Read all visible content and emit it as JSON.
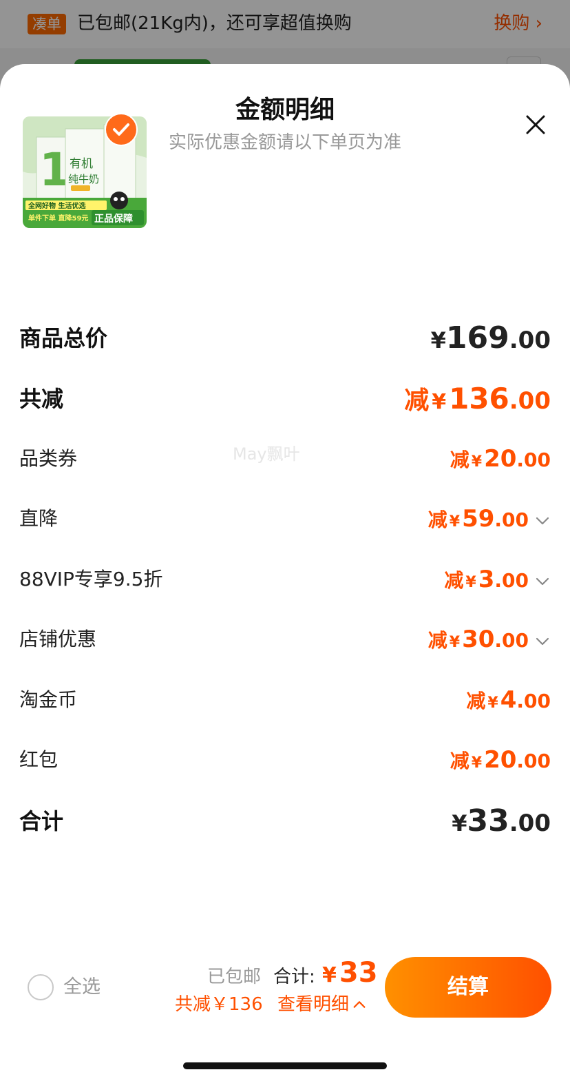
{
  "background": {
    "tag": "凑单",
    "text": "已包邮(21Kg内)，还可享超值换购",
    "link": "换购 ›"
  },
  "sheet": {
    "title": "金额明细",
    "subtitle": "实际优惠金额请以下单页为准",
    "close_icon": "close-icon"
  },
  "product": {
    "image_texts": [
      "有机",
      "纯牛奶",
      "全网好物 生活优选",
      "单件下单 直降59元",
      "正品保障"
    ],
    "selected": true
  },
  "rows": [
    {
      "label": "商品总价",
      "currency": "¥",
      "integer": "169",
      "decimal": ".00"
    },
    {
      "label": "共减",
      "prefix": "减",
      "currency": "¥",
      "integer": "136",
      "decimal": ".00"
    },
    {
      "label": "品类券",
      "prefix": "减",
      "currency": "¥",
      "integer": "20",
      "decimal": ".00"
    },
    {
      "label": "直降",
      "prefix": "减",
      "currency": "¥",
      "integer": "59",
      "decimal": ".00",
      "expandable": true
    },
    {
      "label": "88VIP专享9.5折",
      "prefix": "减",
      "currency": "¥",
      "integer": "3",
      "decimal": ".00",
      "expandable": true
    },
    {
      "label": "店铺优惠",
      "prefix": "减",
      "currency": "¥",
      "integer": "30",
      "decimal": ".00",
      "expandable": true
    },
    {
      "label": "淘金币",
      "prefix": "减",
      "currency": "¥",
      "integer": "4",
      "decimal": ".00"
    },
    {
      "label": "红包",
      "prefix": "减",
      "currency": "¥",
      "integer": "20",
      "decimal": ".00"
    },
    {
      "label": "合计",
      "currency": "¥",
      "integer": "33",
      "decimal": ".00"
    }
  ],
  "watermark": "May飘叶",
  "bottom_bar": {
    "select_all": "全选",
    "shipping": "已包邮",
    "sum_label": "合计:",
    "sum_currency": "¥",
    "sum_amount": "33",
    "saved": "共减￥136",
    "view_detail": "查看明细",
    "checkout": "结算"
  },
  "colors": {
    "accent": "#ff5000",
    "button_gradient_start": "#ff9000",
    "button_gradient_end": "#ff5000",
    "text_dark": "#222222",
    "text_muted": "#999999"
  }
}
